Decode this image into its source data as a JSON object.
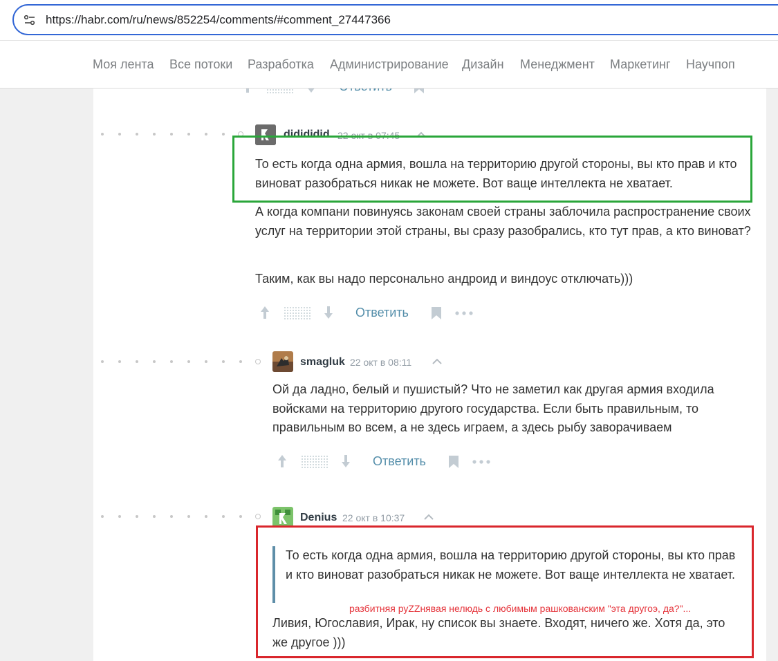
{
  "browser": {
    "url": "https://habr.com/ru/news/852254/comments/#comment_27447366",
    "site_settings_icon": "tune-icon"
  },
  "nav": {
    "items": [
      "Моя лента",
      "Все потоки",
      "Разработка",
      "Администрирование",
      "Дизайн",
      "Менеджмент",
      "Маркетинг",
      "Научпоп"
    ]
  },
  "previous_comment_actions": {
    "reply_label": "Ответить"
  },
  "comments": [
    {
      "username": "didididid",
      "time": "22 окт в 07:45",
      "paragraphs": [
        "То есть когда одна армия, вошла на территорию другой стороны, вы кто прав и кто виноват разобраться никак не можете. Вот ваще интеллекта не хватает.",
        "А когда компани повинуясь законам своей страны заблочила распространение своих услуг на территории этой страны, вы сразу разобрались, кто тут прав, а кто виноват?",
        "Таким, как вы надо персонально андроид и виндоус отключать)))"
      ],
      "reply_label": "Ответить"
    },
    {
      "username": "smagluk",
      "time": "22 окт в 08:11",
      "paragraphs": [
        "Ой да ладно, белый и пушистый? Что не заметил как другая армия входила войсками на территорию другого государства. Если быть правильным, то правильным во всем, а не здесь играем, а здесь рыбу заворачиваем"
      ],
      "reply_label": "Ответить"
    },
    {
      "username": "Denius",
      "time": "22 окт в 10:37",
      "quote": "То есть когда одна армия, вошла на территорию другой стороны, вы кто прав и кто виноват разобраться никак не можете. Вот ваще интеллекта не хватает.",
      "paragraphs": [
        "Ливия, Югославия, Ирак, ну список вы знаете. Входят, ничего же. Хотя да, это же другое )))"
      ]
    }
  ],
  "annotation": {
    "text": "разбитняя руZZнявая нелюдь с любимым рашкованским \"эта другоэ, да?\"...",
    "color": "#e5343b"
  },
  "colors": {
    "green_box": "#2aa63a",
    "red_box": "#d9262c",
    "reply_link": "#548eaa",
    "address_border": "#3367d6"
  }
}
